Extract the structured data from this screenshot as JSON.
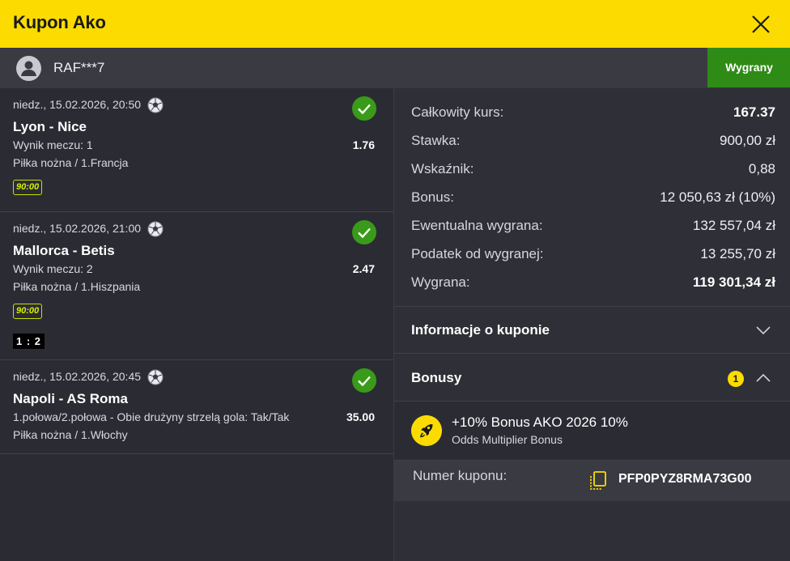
{
  "header": {
    "title": "Kupon Ako"
  },
  "user": {
    "name": "RAF***7"
  },
  "tabs": {
    "winnings": "Wygrany"
  },
  "bets": [
    {
      "datetime": "niedz., 15.02.2026, 20:50",
      "match": "Lyon - Nice",
      "market": "Wynik meczu: 1",
      "odds": "1.76",
      "league": "Piłka nożna / 1.Francja",
      "time": "90:00",
      "score": ""
    },
    {
      "datetime": "niedz., 15.02.2026, 21:00",
      "match": "Mallorca - Betis",
      "market": "Wynik meczu: 2",
      "odds": "2.47",
      "league": "Piłka nożna / 1.Hiszpania",
      "time": "90:00",
      "score": "1 : 2"
    },
    {
      "datetime": "niedz., 15.02.2026, 20:45",
      "match": "Napoli - AS Roma",
      "market": "1.połowa/2.połowa - Obie drużyny strzelą gola: Tak/Tak",
      "odds": "35.00",
      "league": "Piłka nożna / 1.Włochy",
      "time": "",
      "score": ""
    }
  ],
  "summary": [
    {
      "label": "Całkowity kurs:",
      "value": "167.37",
      "bold": true
    },
    {
      "label": "Stawka:",
      "value": "900,00 zł",
      "bold": false
    },
    {
      "label": "Wskaźnik:",
      "value": "0,88",
      "bold": false
    },
    {
      "label": "Bonus:",
      "value": "12 050,63 zł (10%)",
      "bold": false
    },
    {
      "label": "Ewentualna wygrana:",
      "value": "132 557,04 zł",
      "bold": false
    },
    {
      "label": "Podatek od wygranej:",
      "value": "13 255,70 zł",
      "bold": false
    },
    {
      "label": "Wygrana:",
      "value": "119 301,34 zł",
      "bold": true
    }
  ],
  "sections": {
    "info": {
      "title": "Informacje o kuponie"
    },
    "bonuses": {
      "title": "Bonusy",
      "count": "1"
    }
  },
  "bonus": {
    "name": "+10% Bonus AKO 2026 10%",
    "subtitle": "Odds Multiplier Bonus"
  },
  "coupon": {
    "label": "Numer kuponu:",
    "value": "PFP0PYZ8RMA73G00"
  },
  "colors": {
    "brand_yellow": "#fcdc00",
    "win_green": "#2e8b16",
    "check_green": "#3a9a1a",
    "background": "#2b2c33"
  },
  "icons": {
    "close": "close-icon",
    "avatar": "user-avatar-icon",
    "ball": "football-icon",
    "check": "check-circle-icon",
    "chevron_down": "chevron-down-icon",
    "chevron_up": "chevron-up-icon",
    "rocket": "rocket-icon",
    "copy": "copy-icon"
  }
}
